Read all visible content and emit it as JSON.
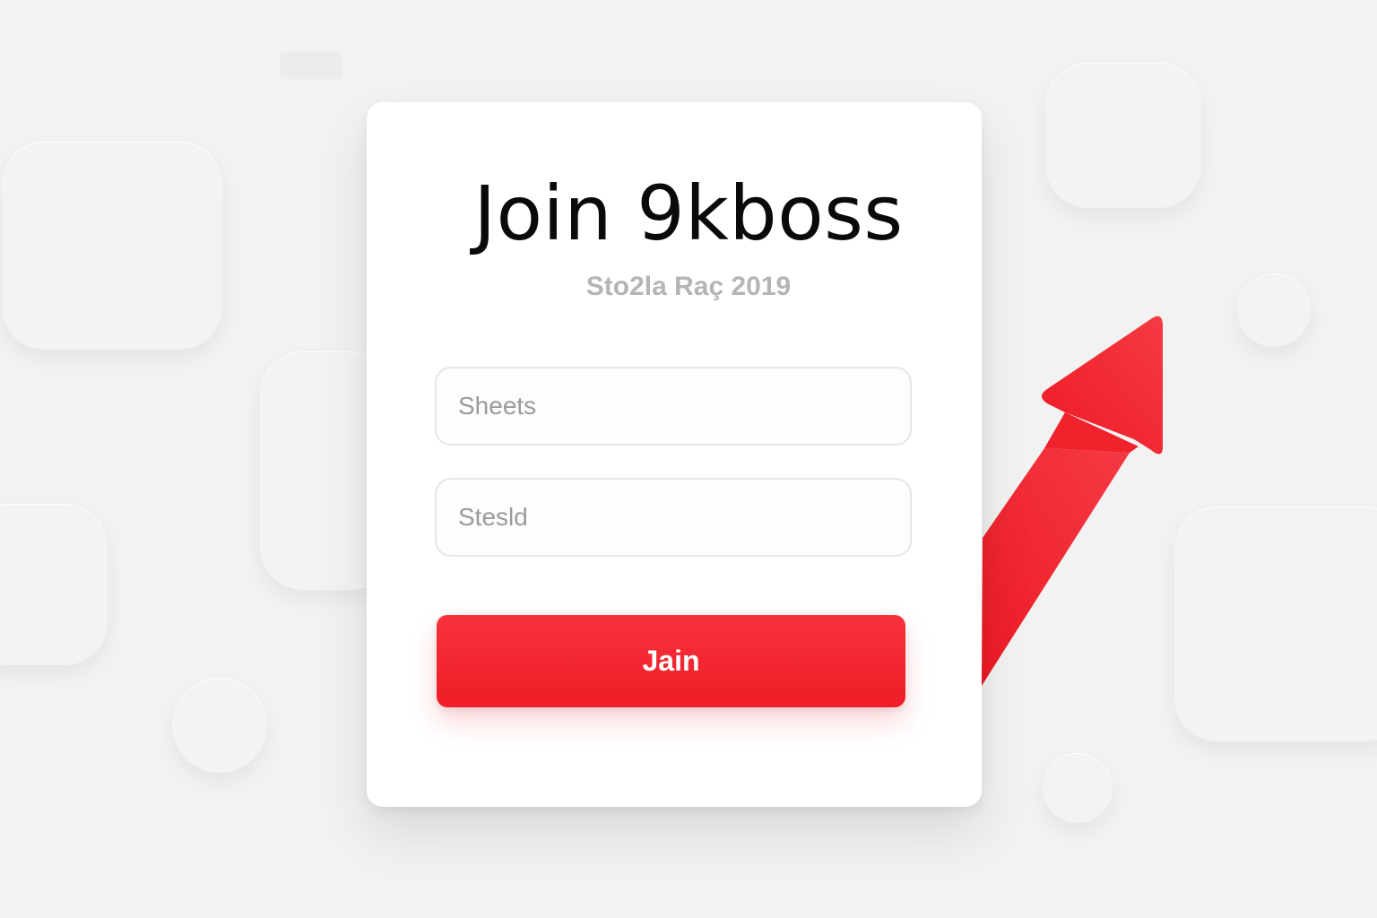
{
  "signup": {
    "title": "Join 9kboss",
    "subtitle": "Sto2la Raç 2019",
    "fields": [
      {
        "placeholder": "Sheets",
        "value": ""
      },
      {
        "placeholder": "Stesld",
        "value": ""
      }
    ],
    "join_label": "Jain"
  },
  "colors": {
    "accent": "#ef1d27",
    "background": "#f2f2f2",
    "card": "#ffffff"
  },
  "icons": {
    "arrow": "trend-up-arrow-icon"
  }
}
